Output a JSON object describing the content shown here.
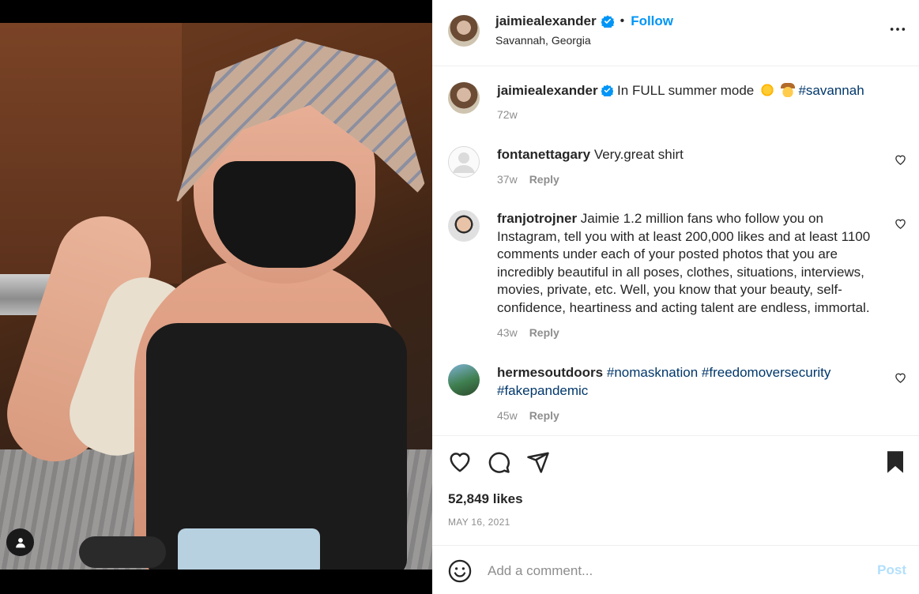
{
  "post": {
    "author": {
      "username": "jaimiealexander",
      "verified": true,
      "follow_label": "Follow",
      "location": "Savannah, Georgia"
    },
    "caption": {
      "username": "jaimiealexander",
      "text": "In FULL summer mode",
      "emojis": [
        "sun-emoji",
        "cowboy-emoji"
      ],
      "hashtag": "#savannah",
      "time": "72w"
    },
    "comments": [
      {
        "username": "fontanettagary",
        "text": "Very.great shirt",
        "time": "37w",
        "reply_label": "Reply"
      },
      {
        "username": "franjotrojner",
        "text": "Jaimie 1.2 million fans who follow you on Instagram, tell you with at least 200,000 likes and at least 1100 comments under each of your posted photos that you are incredibly beautiful in all poses, clothes, situations, interviews, movies, private, etc. Well, you know that your beauty, self-confidence, heartiness and acting talent are endless, immortal.",
        "time": "43w",
        "reply_label": "Reply"
      },
      {
        "username": "hermesoutdoors",
        "hashtags_line1": "#nomasknation #freedomoversecurity",
        "hashtags_line2": "#fakepandemic",
        "time": "45w",
        "reply_label": "Reply"
      }
    ],
    "likes": "52,849 likes",
    "date": "MAY 16, 2021"
  },
  "comment_box": {
    "placeholder": "Add a comment...",
    "post_label": "Post"
  },
  "icons": {
    "verified": "verified-badge-icon",
    "more": "more-options-icon",
    "like": "heart-icon",
    "comment": "comment-icon",
    "share": "share-icon",
    "save": "bookmark-icon",
    "emoji": "emoji-icon",
    "tags": "user-tag-icon"
  },
  "colors": {
    "accent": "#0095f6",
    "hashtag": "#00376b",
    "muted": "#8e8e8e",
    "post_disabled": "#b2dffc"
  }
}
